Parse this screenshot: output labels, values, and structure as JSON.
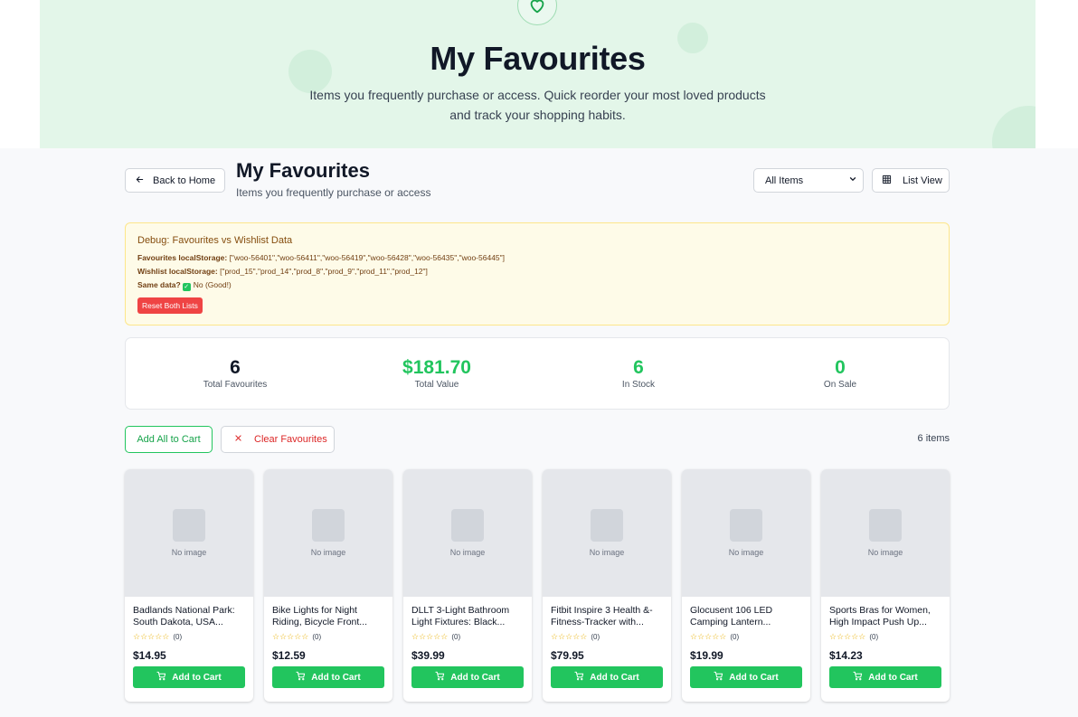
{
  "hero": {
    "title": "My Favourites",
    "subtitle_line1": "Items you frequently purchase or access. Quick reorder your most loved products",
    "subtitle_line2": "and track your shopping habits."
  },
  "header": {
    "back_label": "Back to Home",
    "title": "My Favourites",
    "subtitle": "Items you frequently purchase or access",
    "filter_value": "All Items",
    "view_label": "List View"
  },
  "debug": {
    "title": "Debug: Favourites vs Wishlist Data",
    "fav_label": "Favourites localStorage:",
    "fav_value": " [\"woo-56401\",\"woo-56411\",\"woo-56419\",\"woo-56428\",\"woo-56435\",\"woo-56445\"]",
    "wish_label": "Wishlist localStorage:",
    "wish_value": " [\"prod_15\",\"prod_14\",\"prod_8\",\"prod_9\",\"prod_11\",\"prod_12\"]",
    "same_label": "Same data?",
    "same_value": "No (Good!)",
    "reset_label": "Reset Both Lists"
  },
  "stats": [
    {
      "value": "6",
      "label": "Total Favourites",
      "color": "#111827"
    },
    {
      "value": "$181.70",
      "label": "Total Value",
      "color": "#22c55e"
    },
    {
      "value": "6",
      "label": "In Stock",
      "color": "#22c55e"
    },
    {
      "value": "0",
      "label": "On Sale",
      "color": "#22c55e"
    }
  ],
  "actions": {
    "add_all_label": "Add All to Cart",
    "clear_label": "Clear Favourites",
    "count_label": "6 items"
  },
  "products": [
    {
      "name": "Badlands National Park: South Dakota, USA...",
      "image_text": "No image",
      "reviews": "(0)",
      "price": "$14.95",
      "cart_label": "Add to Cart"
    },
    {
      "name": "Bike Lights for Night Riding, Bicycle Front...",
      "image_text": "No image",
      "reviews": "(0)",
      "price": "$12.59",
      "cart_label": "Add to Cart"
    },
    {
      "name": "DLLT 3-Light Bathroom Light Fixtures: Black...",
      "image_text": "No image",
      "reviews": "(0)",
      "price": "$39.99",
      "cart_label": "Add to Cart"
    },
    {
      "name": "Fitbit Inspire 3 Health &-Fitness-Tracker with...",
      "image_text": "No image",
      "reviews": "(0)",
      "price": "$79.95",
      "cart_label": "Add to Cart"
    },
    {
      "name": "Glocusent 106 LED Camping Lantern...",
      "image_text": "No image",
      "reviews": "(0)",
      "price": "$19.99",
      "cart_label": "Add to Cart"
    },
    {
      "name": "Sports Bras for Women, High Impact Push Up...",
      "image_text": "No image",
      "reviews": "(0)",
      "price": "$14.23",
      "cart_label": "Add to Cart"
    }
  ],
  "colors": {
    "accent": "#22c55e",
    "danger": "#ef4444",
    "hero_bg": "#e3f6e9",
    "debug_bg": "#fefbe8"
  },
  "icons": [
    "heart-icon",
    "arrow-left-icon",
    "chevron-down-icon",
    "grid-icon",
    "close-icon",
    "star-icon",
    "cart-icon"
  ]
}
